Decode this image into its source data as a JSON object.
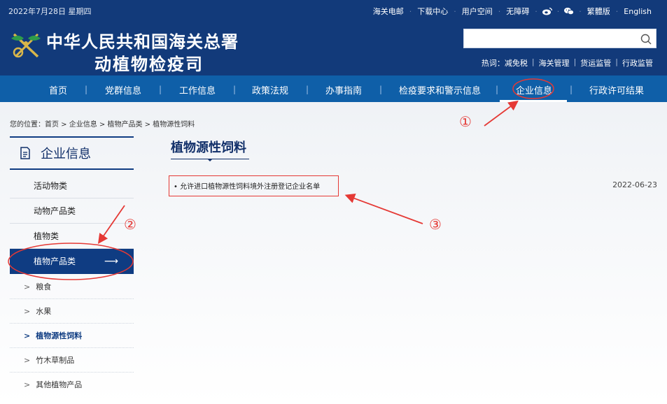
{
  "header": {
    "date": "2022年7月28日 星期四",
    "top_links": [
      "海关电邮",
      "下载中心",
      "用户空间",
      "无障碍"
    ],
    "top_links_right": [
      "繁體版",
      "English"
    ],
    "title_line1": "中华人民共和国海关总署",
    "title_line2": "动植物检疫司",
    "search_placeholder": "",
    "hot_label": "热词：",
    "hot_words": [
      "减免税",
      "海关管理",
      "货运监管",
      "行政监管"
    ],
    "icons": [
      "weibo-icon",
      "wechat-icon",
      "search-icon"
    ]
  },
  "nav": {
    "items": [
      "首页",
      "党群信息",
      "工作信息",
      "政策法规",
      "办事指南",
      "检疫要求和警示信息",
      "企业信息",
      "行政许可结果"
    ],
    "active": "企业信息"
  },
  "breadcrumb": "您的位置：首页 > 企业信息 > 植物产品类 > 植物源性饲料",
  "sidebar": {
    "title": "企业信息",
    "items": [
      "活动物类",
      "动物产品类",
      "植物类",
      "植物产品类"
    ],
    "active_item": "植物产品类",
    "arrow": "⟶",
    "sub_items": [
      "粮食",
      "水果",
      "植物源性饲料",
      "竹木草制品",
      "其他植物产品"
    ],
    "active_sub": "植物源性饲料",
    "sub_prefix": ">"
  },
  "main": {
    "title": "植物源性饲料",
    "articles": [
      {
        "bullet": "•",
        "title": "允许进口植物源性饲料境外注册登记企业名单",
        "date": "2022-06-23"
      }
    ]
  },
  "annotations": {
    "one": "①",
    "two": "②",
    "three": "③",
    "color": "#e53935"
  },
  "colors": {
    "header_bg": "#123a7a",
    "nav_bg": "#0f5fa8",
    "sidebar_active": "#0f3c82"
  }
}
